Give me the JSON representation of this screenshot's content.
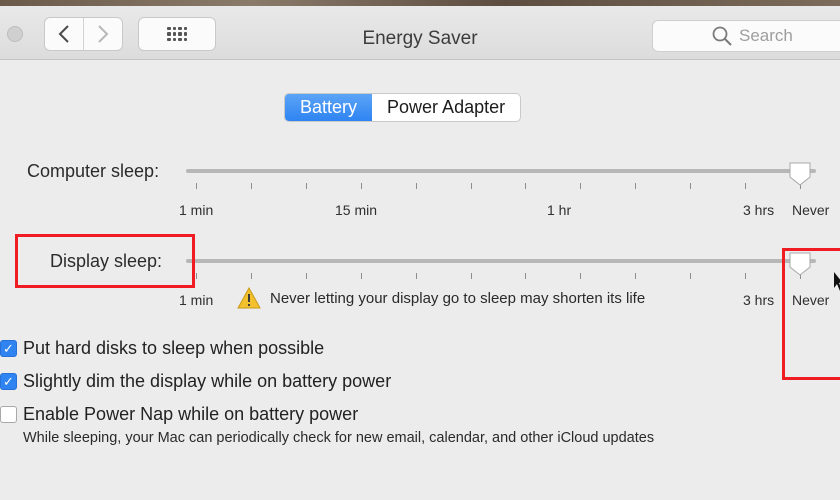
{
  "window": {
    "title": "Energy Saver"
  },
  "toolbar": {
    "back_icon": "chevron-left-icon",
    "forward_icon": "chevron-right-icon",
    "show_all_icon": "grid-icon"
  },
  "search": {
    "placeholder": "Search"
  },
  "tabs": [
    {
      "label": "Battery",
      "selected": true
    },
    {
      "label": "Power Adapter",
      "selected": false
    }
  ],
  "computer_sleep": {
    "label": "Computer sleep:",
    "value": "Never",
    "tick_labels": [
      "1 min",
      "15 min",
      "1 hr",
      "3 hrs",
      "Never"
    ]
  },
  "display_sleep": {
    "label": "Display sleep:",
    "value": "Never",
    "tick_labels": [
      "1 min",
      "3 hrs",
      "Never"
    ],
    "warning": "Never letting your display go to sleep may shorten its life"
  },
  "options": [
    {
      "label": "Put hard disks to sleep when possible",
      "checked": true
    },
    {
      "label": "Slightly dim the display while on battery power",
      "checked": true
    },
    {
      "label": "Enable Power Nap while on battery power",
      "checked": false
    }
  ],
  "power_nap_note": "While sleeping, your Mac can periodically check for new email, calendar, and other iCloud updates",
  "colors": {
    "accent": "#2f84f2",
    "highlight": "#ef1c24"
  }
}
